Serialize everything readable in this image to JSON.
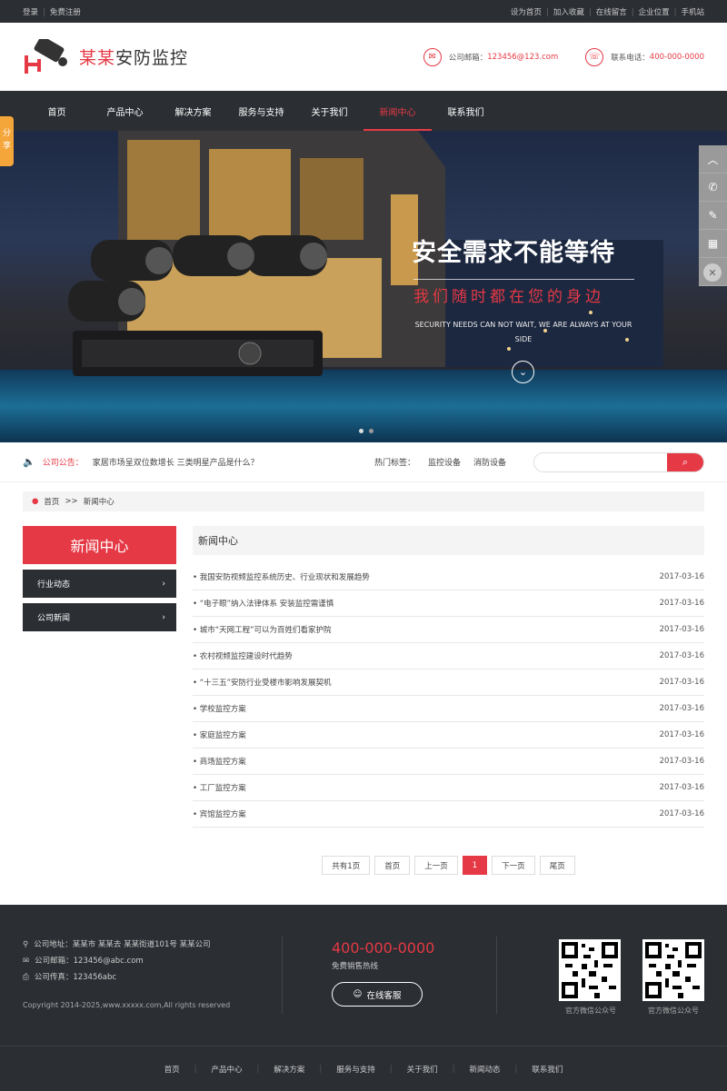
{
  "topbar": {
    "left": [
      "登录",
      "免费注册"
    ],
    "right": [
      "设为首页",
      "加入收藏",
      "在线留言",
      "企业位置",
      "手机站"
    ]
  },
  "header": {
    "logo_red": "某某",
    "logo_black": "安防监控",
    "email_label": "公司邮箱：",
    "email_value": "123456@123.com",
    "phone_label": "联系电话：",
    "phone_value": "400-000-0000"
  },
  "nav": {
    "items": [
      "首页",
      "产品中心",
      "解决方案",
      "服务与支持",
      "关于我们",
      "新闻中心",
      "联系我们"
    ],
    "active": "新闻中心"
  },
  "banner": {
    "title": "安全需求不能等待",
    "subtitle": "我们随时都在您的身边",
    "english": "SECURITY NEEDS CAN NOT WAIT, WE ARE ALWAYS AT YOUR SIDE"
  },
  "share": "分享",
  "notice": {
    "label": "公司公告：",
    "text": "家居市场呈双位数增长 三类明星产品是什么？",
    "tags_label": "热门标签：",
    "tags": [
      "监控设备",
      "消防设备"
    ],
    "search_placeholder": ""
  },
  "breadcrumb": {
    "home": "首页",
    "sep": ">>",
    "current": "新闻中心"
  },
  "left": {
    "title": "新闻中心",
    "items": [
      "行业动态",
      "公司新闻"
    ]
  },
  "right": {
    "title": "新闻中心",
    "news": [
      {
        "title": "• 我国安防视频监控系统历史、行业现状和发展趋势",
        "date": "2017-03-16"
      },
      {
        "title": "• “电子眼”纳入法律体系 安装监控需谨慎",
        "date": "2017-03-16"
      },
      {
        "title": "• 城市“天网工程”可以为百姓们看家护院",
        "date": "2017-03-16"
      },
      {
        "title": "• 农村视频监控建设时代趋势",
        "date": "2017-03-16"
      },
      {
        "title": "• “十三五”安防行业受楼市影响发展契机",
        "date": "2017-03-16"
      },
      {
        "title": "• 学校监控方案",
        "date": "2017-03-16"
      },
      {
        "title": "• 家庭监控方案",
        "date": "2017-03-16"
      },
      {
        "title": "• 商场监控方案",
        "date": "2017-03-16"
      },
      {
        "title": "• 工厂监控方案",
        "date": "2017-03-16"
      },
      {
        "title": "• 宾馆监控方案",
        "date": "2017-03-16"
      }
    ]
  },
  "pager": [
    "共有1页",
    "首页",
    "上一页",
    "1",
    "下一页",
    "尾页"
  ],
  "footer": {
    "address": "公司地址：某某市 某某去 某某街道101号 某某公司",
    "email": "公司邮箱：123456@abc.com",
    "fax": "公司传真：123456abc",
    "copyright": "Copyright 2014-2025,www.xxxxx.com,All rights reserved",
    "phone": "400-000-0000",
    "hotline": "免费销售热线",
    "service": "在线客服",
    "qr1": "官方微信公众号",
    "qr2": "官方微信公众号",
    "nav": [
      "首页",
      "产品中心",
      "解决方案",
      "服务与支持",
      "关于我们",
      "新闻动态",
      "联系我们"
    ]
  }
}
